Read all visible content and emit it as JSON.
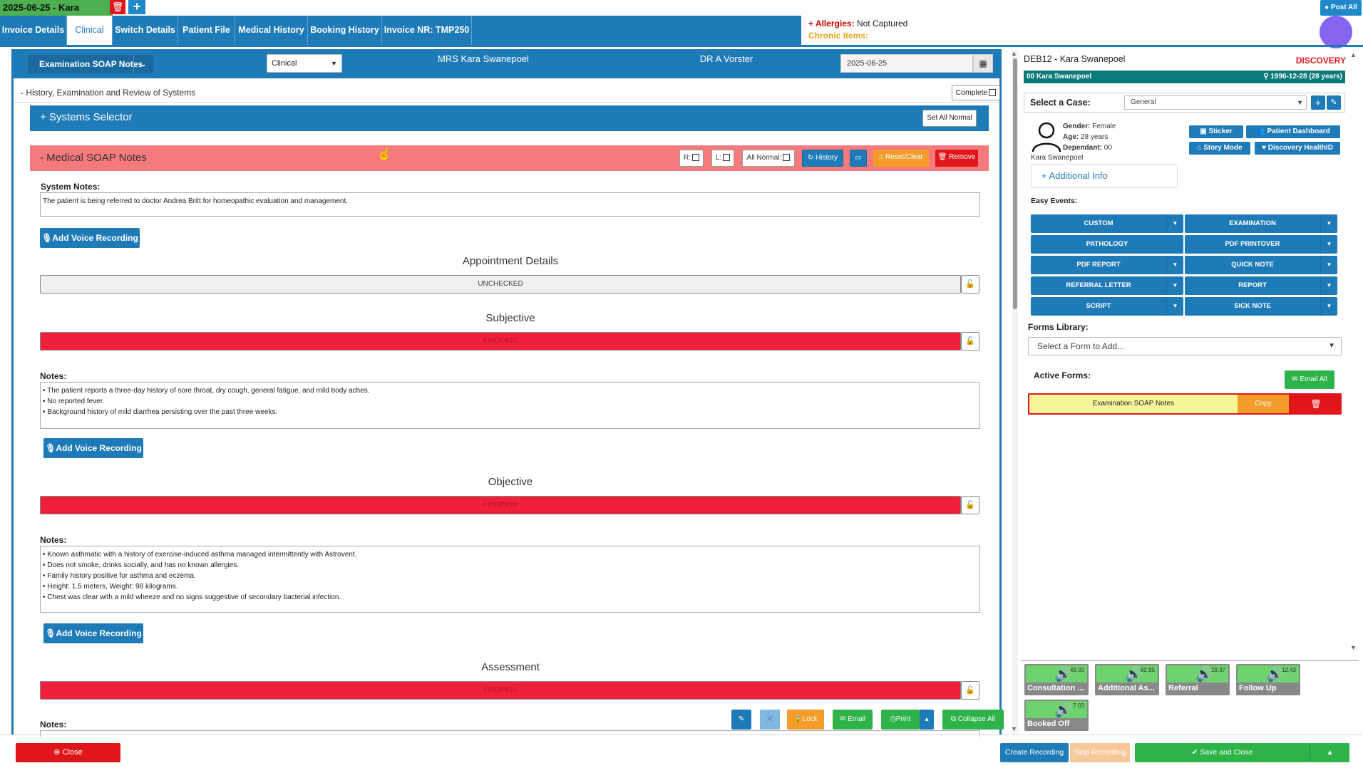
{
  "top": {
    "doc_tab": "2025-06-25 - Kara",
    "delete_icon": "trash-icon",
    "add_icon": "+",
    "post_all": "Post All"
  },
  "nav": {
    "tabs": [
      "Invoice Details",
      "Clinical",
      "Switch Details",
      "Patient File",
      "Medical History",
      "Booking History",
      "Invoice NR: TMP250"
    ],
    "active": "Clinical"
  },
  "allergy": {
    "allergies_label": "+ Allergies:",
    "allergies_value": "Not Captured",
    "chronic_label": "Chronic Items:"
  },
  "header": {
    "form_select": "Examination SOAP Notes",
    "dd_caret": "⌄",
    "type_select": "Clinical",
    "patient": "MRS Kara Swanepoel",
    "doctor": "DR A Vorster",
    "date": "2025-06-25"
  },
  "history_row": {
    "label": "- History, Examination and Review of Systems",
    "complete": "Complete"
  },
  "systems": {
    "label": "+ Systems Selector",
    "set_all_normal": "Set All Normal"
  },
  "med_soap": {
    "label": "- Medical SOAP Notes",
    "r_label": "R:",
    "l_label": "L:",
    "all_normal": "All Normal:",
    "history": "History",
    "reset": "Reset/Clear",
    "remove": "Remove"
  },
  "system_notes": {
    "label": "System Notes:",
    "text": "The patient is being referred to doctor Andrea Britt for homeopathic evaluation and management."
  },
  "voice": "Add Voice Recording",
  "appointment": {
    "title": "Appointment Details",
    "status": "UNCHECKED"
  },
  "subjective": {
    "title": "Subjective",
    "status": "FINDINGS",
    "notes_label": "Notes:",
    "lines": [
      "• The patient reports a three-day history of sore throat, dry cough, general fatigue, and mild body aches.",
      "• No reported fever.",
      "• Background history of mild diarrhea persisting over the past three weeks."
    ]
  },
  "objective": {
    "title": "Objective",
    "status": "FINDINGS",
    "notes_label": "Notes:",
    "lines": [
      "• Known asthmatic with a history of exercise-induced asthma managed intermittently with Astrovent.",
      "• Does not smoke, drinks socially, and has no known allergies.",
      "• Family history positive for asthma and eczema.",
      "• Height: 1.5 meters, Weight: 98 kilograms.",
      "• Chest was clear with a mild wheeze and no signs suggestive of secondary bacterial infection."
    ]
  },
  "assessment": {
    "title": "Assessment",
    "status": "FINDINGS",
    "notes_label": "Notes:"
  },
  "floating_toolbar": {
    "lock": "Lock",
    "email": "Email",
    "print": "Print",
    "collapse_all": "Collapse All"
  },
  "bottom": {
    "close": "Close",
    "create_recording": "Create Recording",
    "stop_recording": "Stop Recording",
    "save_and_close": "Save and Close"
  },
  "right_panel": {
    "title": "DEB12 - Kara Swanepoel",
    "discovery": "DISCOVERY",
    "bar_left": "00 Kara Swanepoel",
    "bar_dob": "1996-12-28 (28 years)",
    "case_label": "Select a Case:",
    "case_value": "General",
    "gender_label": "Gender:",
    "gender": "Female",
    "age_label": "Age:",
    "age": "28 years",
    "dependant_label": "Dependant:",
    "dependant": "00",
    "patient_name": "Kara Swanepoel",
    "buttons": [
      "Sticker",
      "Patient Dashboard",
      "Story Mode",
      "Discovery HealthID"
    ],
    "additional_info": "+ Additional Info",
    "easy_events_label": "Easy Events:",
    "events": [
      "CUSTOM",
      "EXAMINATION",
      "PATHOLOGY",
      "PDF PRINTOVER",
      "PDF REPORT",
      "QUICK NOTE",
      "REFERRAL LETTER",
      "REPORT",
      "SCRIPT",
      "SICK NOTE"
    ],
    "forms_library_label": "Forms Library:",
    "forms_placeholder": "Select a Form to Add...",
    "active_forms_label": "Active Forms:",
    "email_all": "Email All",
    "active_form": "Examination SOAP Notes",
    "copy": "Copy",
    "recordings": [
      {
        "name": "Consultation ...",
        "dur": "49.33"
      },
      {
        "name": "Additional As...",
        "dur": "82.95"
      },
      {
        "name": "Referral",
        "dur": "29.37"
      },
      {
        "name": "Follow Up",
        "dur": "12.43"
      },
      {
        "name": "Booked Off",
        "dur": "7.03"
      }
    ]
  }
}
